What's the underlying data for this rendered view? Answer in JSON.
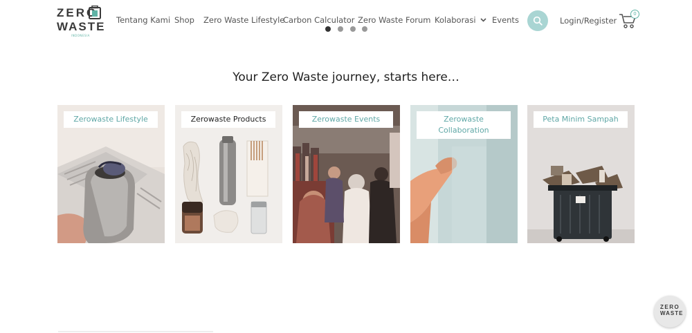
{
  "brand": {
    "line1": "ZERO",
    "line2": "WASTE",
    "sub": "INDONESIA"
  },
  "nav": {
    "items": [
      {
        "label": "Tentang Kami"
      },
      {
        "label": "Shop"
      },
      {
        "label": "Zero Waste Lifestyle"
      },
      {
        "label": "Carbon Calculator"
      },
      {
        "label": "Zero Waste Forum"
      },
      {
        "label": "Kolaborasi"
      },
      {
        "label": "Events"
      }
    ],
    "login_label": "Login/Register",
    "cart_count": "0"
  },
  "carousel": {
    "active_index": 0,
    "count": 4
  },
  "hero": {
    "tagline": "Your Zero Waste journey, starts here…"
  },
  "cards": [
    {
      "label": "Zerowaste Lifestyle",
      "icon": "steel-bottle-photo"
    },
    {
      "label": "Zerowaste Products",
      "icon": "reusable-products-photo"
    },
    {
      "label": "Zerowaste Events",
      "icon": "market-crowd-photo"
    },
    {
      "label": "Zerowaste Collaboration",
      "icon": "handshake-photo"
    },
    {
      "label": "Peta Minim Sampah",
      "icon": "trash-bin-photo"
    }
  ],
  "colors": {
    "accent": "#a9d5d3",
    "brand_green": "#5fb3a5",
    "label_teal": "#5fa7a6"
  }
}
